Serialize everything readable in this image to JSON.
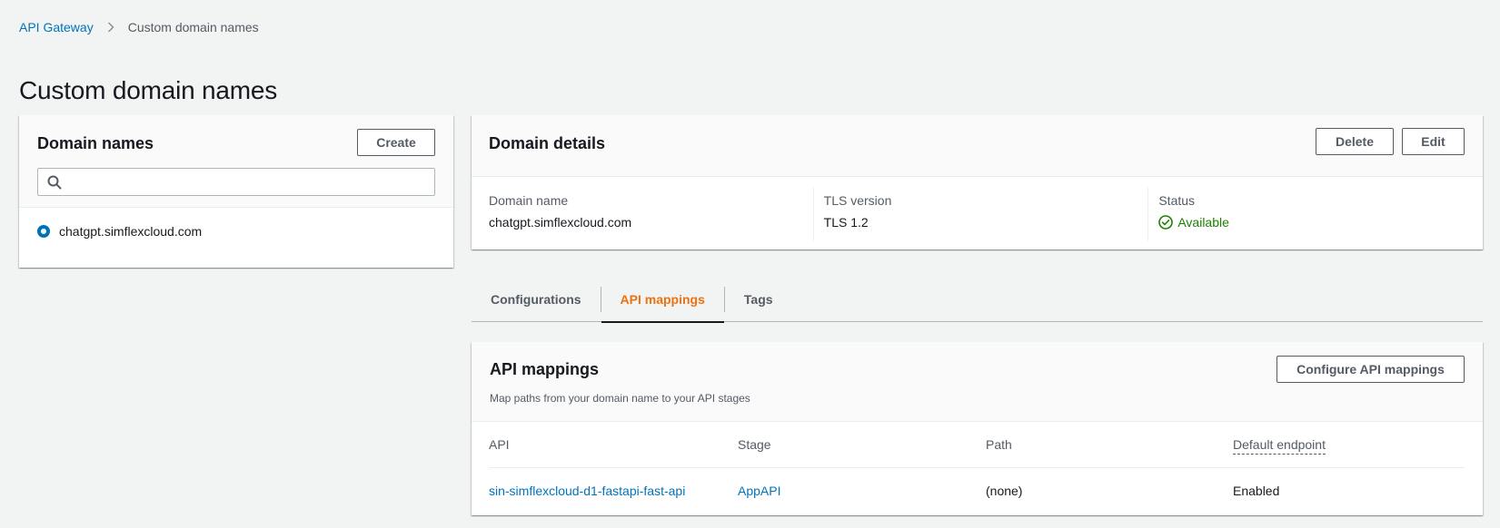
{
  "breadcrumb": {
    "root": "API Gateway",
    "current": "Custom domain names"
  },
  "page": {
    "title": "Custom domain names"
  },
  "domain_list": {
    "title": "Domain names",
    "create_label": "Create",
    "search_placeholder": "",
    "items": [
      {
        "label": "chatgpt.simflexcloud.com",
        "selected": true
      }
    ]
  },
  "details": {
    "title": "Domain details",
    "delete_label": "Delete",
    "edit_label": "Edit",
    "domain_name_label": "Domain name",
    "domain_name_value": "chatgpt.simflexcloud.com",
    "tls_label": "TLS version",
    "tls_value": "TLS 1.2",
    "status_label": "Status",
    "status_value": "Available"
  },
  "tabs": [
    {
      "label": "Configurations",
      "active": false
    },
    {
      "label": "API mappings",
      "active": true
    },
    {
      "label": "Tags",
      "active": false
    }
  ],
  "mappings": {
    "title": "API mappings",
    "description": "Map paths from your domain name to your API stages",
    "configure_label": "Configure API mappings",
    "columns": [
      "API",
      "Stage",
      "Path",
      "Default endpoint"
    ],
    "rows": [
      {
        "api": "sin-simflexcloud-d1-fastapi-fast-api",
        "stage": "AppAPI",
        "path": "(none)",
        "default_endpoint": "Enabled"
      }
    ]
  },
  "colors": {
    "link": "#0073bb",
    "active_tab": "#ec7211",
    "success": "#1d8102",
    "text": "#16191f",
    "muted": "#545b64",
    "background": "#f2f3f3"
  },
  "icons": {
    "breadcrumb_separator": "chevron-right-icon",
    "search": "search-icon",
    "status": "check-circle-icon"
  }
}
